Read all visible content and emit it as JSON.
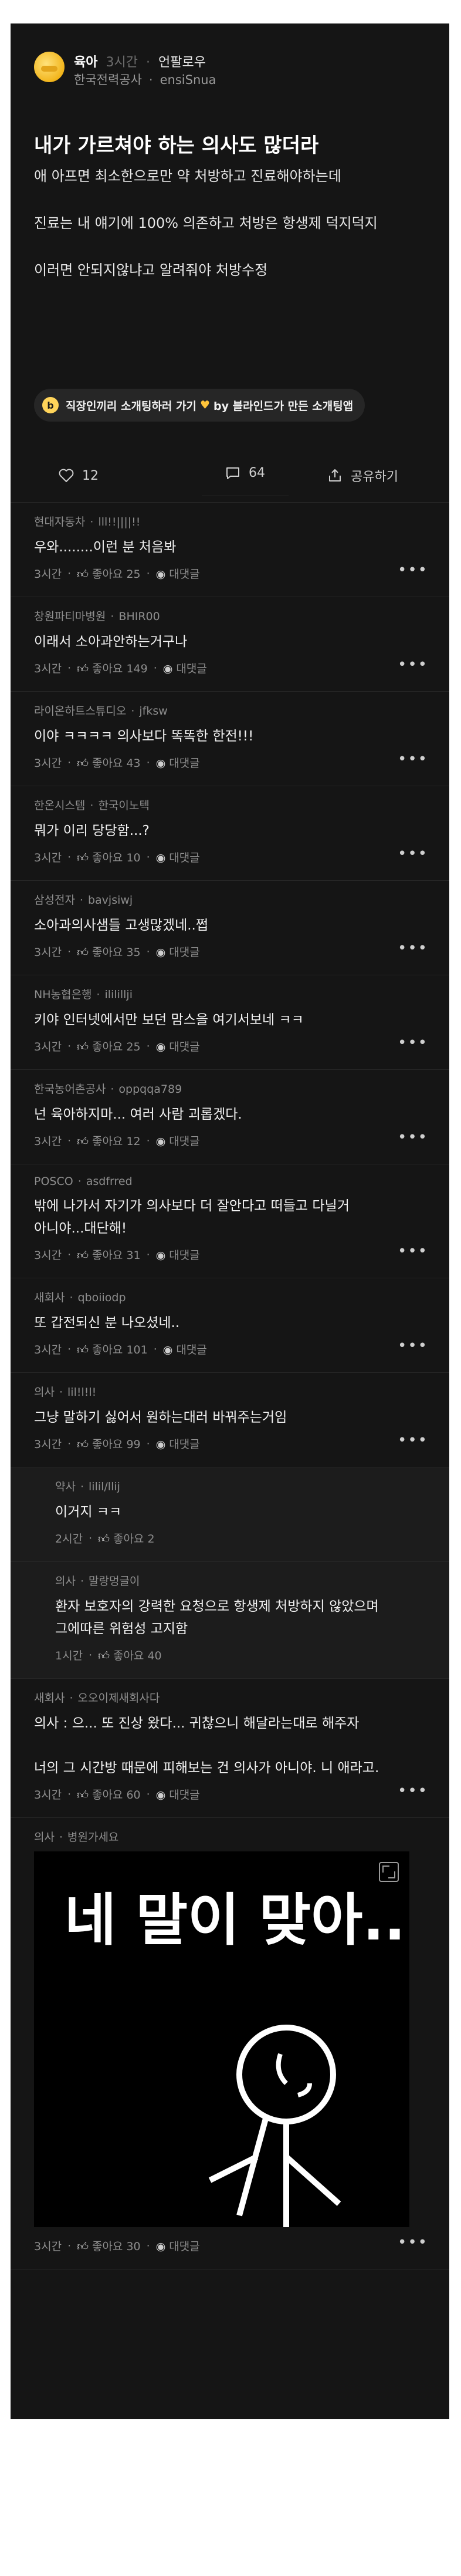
{
  "post": {
    "author_name": "육아",
    "time_ago": "3시간",
    "follow_label": "언팔로우",
    "company": "한국전력공사",
    "nickname": "ensiSnua",
    "title": "내가 가르쳐야 하는 의사도 많더라",
    "body": [
      "애 아프면 최소한으로만 약 처방하고 진료해야하는데",
      "진료는 내 얘기에 100% 의존하고 처방은 항생제 덕지덕지",
      "이러면 안되지않냐고 알려줘야 처방수정"
    ],
    "banner": {
      "icon_letter": "b",
      "text_before": "직장인끼리 소개팅하러 가기",
      "text_after": "by 블라인드가 만든 소개팅앱"
    },
    "likes": "12",
    "comments": "64",
    "share_label": "공유하기"
  },
  "comment_labels": {
    "like": "좋아요",
    "reply": "대댓글"
  },
  "comments": [
    {
      "company": "현대자동차",
      "nick": "lll!!||||!!",
      "text": "우와........이런 분 처음봐",
      "time": "3시간",
      "likes": "25",
      "reply": true
    },
    {
      "company": "창원파티마병원",
      "nick": "BHIR00",
      "text": "이래서 소아과안하는거구나",
      "time": "3시간",
      "likes": "149",
      "reply": true
    },
    {
      "company": "라이온하트스튜디오",
      "nick": "jfksw",
      "text": "이야 ㅋㅋㅋㅋ 의사보다 똑똑한 한전!!!",
      "time": "3시간",
      "likes": "43",
      "reply": true
    },
    {
      "company": "한온시스템",
      "nick": "한국이노텍",
      "text": "뭐가 이리 당당함...?",
      "time": "3시간",
      "likes": "10",
      "reply": true
    },
    {
      "company": "삼성전자",
      "nick": "bavjsiwj",
      "text": "소아과의사샘들 고생많겠네..쩝",
      "time": "3시간",
      "likes": "35",
      "reply": true
    },
    {
      "company": "NH농협은행",
      "nick": "ililillji",
      "text": "키야 인터넷에서만 보던 맘스을 여기서보네 ㅋㅋ",
      "time": "3시간",
      "likes": "25",
      "reply": true
    },
    {
      "company": "한국농어촌공사",
      "nick": "oppqqa789",
      "text": "넌 육아하지마... 여러 사람 괴롭겠다.",
      "time": "3시간",
      "likes": "12",
      "reply": true
    },
    {
      "company": "POSCO",
      "nick": "asdfrred",
      "text": "밖에 나가서 자기가 의사보다 더 잘안다고 떠들고 다닐거\n아니야...대단해!",
      "time": "3시간",
      "likes": "31",
      "reply": true
    },
    {
      "company": "새회사",
      "nick": "qboiiodp",
      "text": "또 갑전되신 분 나오셨네..",
      "time": "3시간",
      "likes": "101",
      "reply": true
    },
    {
      "company": "의사",
      "nick": "lil!l!l!",
      "text": "그냥 말하기 싫어서 원하는대러 바꿔주는거임",
      "time": "3시간",
      "likes": "99",
      "reply": true
    },
    {
      "company": "약사",
      "nick": "lilil/llij",
      "text": "이거지 ㅋㅋ",
      "time": "2시간",
      "likes": "2",
      "reply": false,
      "is_reply": true
    },
    {
      "company": "의사",
      "nick": "말랑멍글이",
      "text": "환자 보호자의 강력한 요청으로 항생제 처방하지 않았으며\n그에따른 위험성 고지함",
      "time": "1시간",
      "likes": "40",
      "reply": false,
      "is_reply": true
    },
    {
      "company": "새회사",
      "nick": "오오이제새회사다",
      "text": "의사 : 으... 또 진상 왔다... 귀찮으니 해달라는대로 해주자\n\n너의 그 시간방 때문에 피해보는 건 의사가 아니야. 니 애라고.",
      "time": "3시간",
      "likes": "60",
      "reply": true
    },
    {
      "company": "의사",
      "nick": "병원가세요",
      "text": "",
      "time": "3시간",
      "likes": "30",
      "reply": true,
      "image_text": "네 말이 맞아..."
    }
  ],
  "colors": {
    "background": "#151515",
    "accent_heart": "#ffc43a",
    "avatar": "#f2b51c"
  }
}
